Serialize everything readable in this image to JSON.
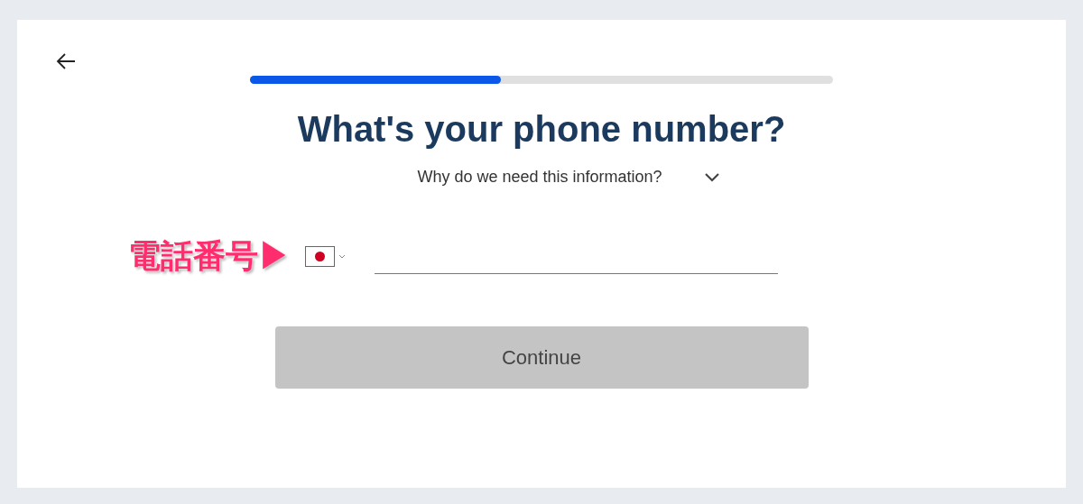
{
  "progress": {
    "level": 0.43
  },
  "title": "What's your phone number?",
  "info_toggle": {
    "label": "Why do we need this information?",
    "expanded": false
  },
  "annotation": "電話番号▶",
  "continue_button": {
    "label": "Continue",
    "disabled": true
  }
}
